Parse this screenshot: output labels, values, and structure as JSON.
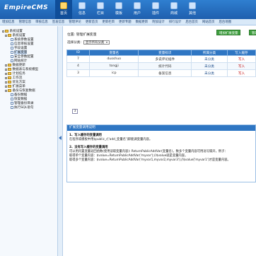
{
  "header": {
    "logo": "EmpireCMS",
    "nav": [
      {
        "label": "首页",
        "icon": "home-icon",
        "active": true
      },
      {
        "label": "信息",
        "icon": "info-icon"
      },
      {
        "label": "栏目",
        "icon": "column-icon"
      },
      {
        "label": "模板",
        "icon": "template-icon"
      },
      {
        "label": "用户",
        "icon": "user-icon"
      },
      {
        "label": "插件",
        "icon": "plugin-icon"
      },
      {
        "label": "商城",
        "icon": "shop-icon"
      },
      {
        "label": "其他",
        "icon": "other-icon"
      }
    ]
  },
  "subnav": [
    "增加信息",
    "管理信息",
    "审核信息",
    "签发信息",
    "管理评论",
    "更新首页",
    "更新栏目",
    "更新专题",
    "数据更新",
    "附加设计",
    "排行设计",
    "后台首页",
    "网站首页",
    "后台地图"
  ],
  "tree": [
    {
      "label": "系统设置",
      "type": "folder",
      "indent": 0
    },
    {
      "label": "系统设置",
      "type": "folder",
      "indent": 1
    },
    {
      "label": "系统参数设置",
      "type": "doc",
      "indent": 2
    },
    {
      "label": "信息审核设置",
      "type": "doc",
      "indent": 2
    },
    {
      "label": "字段设置",
      "type": "doc",
      "indent": 2
    },
    {
      "label": "扩展变量",
      "type": "doc",
      "indent": 2,
      "selected": true
    },
    {
      "label": "安全参数配置",
      "type": "doc",
      "indent": 2
    },
    {
      "label": "网站统计",
      "type": "doc",
      "indent": 2
    },
    {
      "label": "数据更新",
      "type": "folder",
      "indent": 1
    },
    {
      "label": "数据表与系统模型",
      "type": "folder",
      "indent": 1
    },
    {
      "label": "计划任务",
      "type": "folder",
      "indent": 1
    },
    {
      "label": "工作流",
      "type": "folder",
      "indent": 1
    },
    {
      "label": "优化方案",
      "type": "folder",
      "indent": 1
    },
    {
      "label": "扩展菜单",
      "type": "folder",
      "indent": 1
    },
    {
      "label": "备份与恢复数据",
      "type": "folder",
      "indent": 1
    },
    {
      "label": "备份数据",
      "type": "doc",
      "indent": 2
    },
    {
      "label": "恢复数据",
      "type": "doc",
      "indent": 2
    },
    {
      "label": "管理备份目录",
      "type": "doc",
      "indent": 2
    },
    {
      "label": "执行SQL语句",
      "type": "doc",
      "indent": 2
    }
  ],
  "main": {
    "breadcrumb": "位置: 管理扩展变量",
    "add_button": "增加扩展变量",
    "manage_button": "管理",
    "filter_label": "选择分类:",
    "filter_value": "显示所有分类",
    "table": {
      "headers": [
        "ID",
        "变量名",
        "变量标识",
        "所属分类",
        "写入缓存"
      ],
      "rows": [
        [
          "7",
          "duoshuo",
          "多说评论插件",
          "未分类",
          "写入"
        ],
        [
          "4",
          "tongji",
          "统计代码",
          "未分类",
          "写入"
        ],
        [
          "3",
          "icp",
          "备案信息",
          "未分类",
          "写入"
        ]
      ]
    },
    "pager": "3",
    "help": {
      "title": "扩展变量调用说明",
      "h1": "1、写入缓存的变量调用",
      "p1": "在程序或模板中用$public_r['add_变量名']即能调变量内容。",
      "h2": "2、没有写入缓存的变量调用",
      "p2a": "可以用内置变量返回函数(使用读取变量内容): ReturnPublicAddVar(变量名)，数多个变量内容可用逗号隔开，例子：",
      "p2b": "取得单个变量内容：$value=ReturnPublicAddVar('myvar');//$value就是变量内容。",
      "p2c": "取得多个变量内容：$value=ReturnPublicAddVar('myvar1,myvar2,myvar3');//$value['myvar1']才是变量内容。"
    }
  }
}
